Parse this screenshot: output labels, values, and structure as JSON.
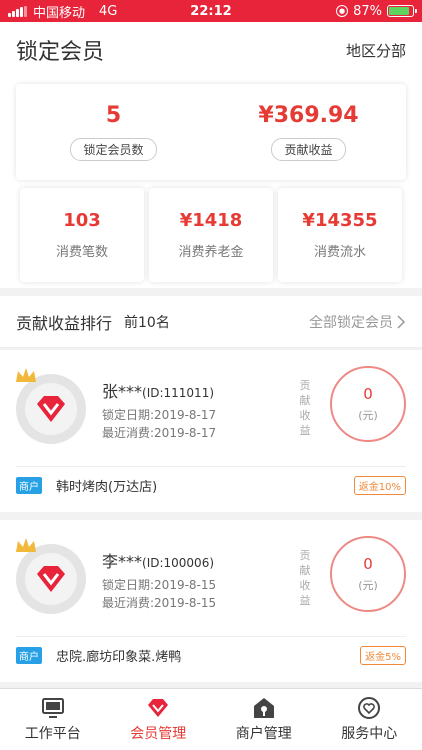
{
  "status_bar": {
    "carrier": "中国移动",
    "network": "4G",
    "time": "22:12",
    "battery_pct": "87%",
    "battery_level": 0.87
  },
  "header": {
    "title": "锁定会员",
    "region_label": "地区分部"
  },
  "stats": {
    "locked_members": {
      "value": "5",
      "label": "锁定会员数"
    },
    "contribution": {
      "value": "¥369.94",
      "label": "贡献收益"
    }
  },
  "small_stats": [
    {
      "value": "103",
      "label": "消费笔数"
    },
    {
      "value": "¥1418",
      "label": "消费养老金"
    },
    {
      "value": "¥14355",
      "label": "消费流水"
    }
  ],
  "ranking": {
    "title": "贡献收益排行",
    "subtitle": "前10名",
    "all_link": "全部锁定会员"
  },
  "members": [
    {
      "name": "张***",
      "id_text": "(ID:111011)",
      "lock_date": "锁定日期:2019-8-17",
      "last_consume": "最近消费:2019-8-17",
      "vertical_label": "贡献收益",
      "value": "0",
      "unit": "(元)",
      "shop_tag": "商户",
      "shop_name": "韩时烤肉(万达店)",
      "rebate": "返金10%"
    },
    {
      "name": "李***",
      "id_text": "(ID:100006)",
      "lock_date": "锁定日期:2019-8-15",
      "last_consume": "最近消费:2019-8-15",
      "vertical_label": "贡献收益",
      "value": "0",
      "unit": "(元)",
      "shop_tag": "商户",
      "shop_name": "忠院.廊坊印象菜.烤鸭",
      "rebate": "返金5%"
    }
  ],
  "tabs": [
    {
      "label": "工作平台",
      "icon": "monitor-icon",
      "active": false
    },
    {
      "label": "会员管理",
      "icon": "diamond-icon",
      "active": true
    },
    {
      "label": "商户管理",
      "icon": "shop-icon",
      "active": false
    },
    {
      "label": "服务中心",
      "icon": "heart-icon",
      "active": false
    }
  ],
  "colors": {
    "brand_red": "#e8243a",
    "value_red": "#e63a35",
    "tag_blue": "#27a0e6",
    "rebate_orange": "#f08a3a"
  }
}
